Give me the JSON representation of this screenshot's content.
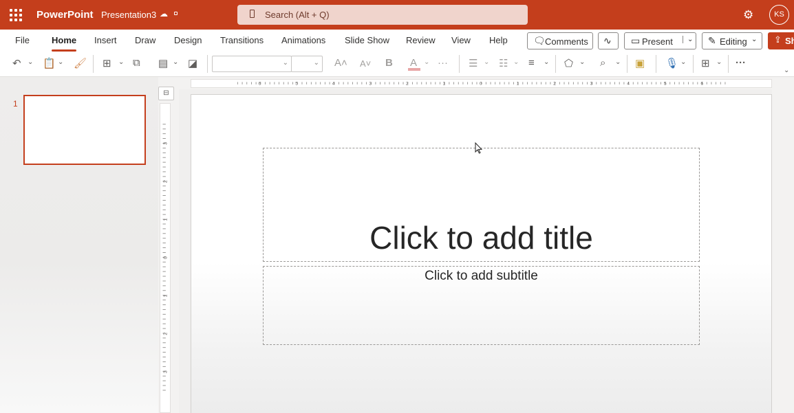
{
  "app": {
    "name": "PowerPoint",
    "document": "Presentation3",
    "search_placeholder": "Search (Alt + Q)",
    "user_initials": "KS"
  },
  "tabs": [
    "File",
    "Home",
    "Insert",
    "Draw",
    "Design",
    "Transitions",
    "Animations",
    "Slide Show",
    "Review",
    "View",
    "Help"
  ],
  "active_tab": "Home",
  "actions": {
    "comments": "Comments",
    "present": "Present",
    "editing": "Editing",
    "share": "Sh"
  },
  "ribbon": {
    "bold": "B",
    "font_color": "A",
    "more": "···",
    "grow_font": "A˄",
    "shrink_font": "A˅"
  },
  "slides": {
    "count_label": "1"
  },
  "placeholders": {
    "title": "Click to add title",
    "subtitle": "Click to add subtitle"
  },
  "ruler": {
    "h_ticks": [
      "6",
      "5",
      "4",
      "3",
      "2",
      "1",
      "0",
      "1",
      "2",
      "3",
      "4",
      "5",
      "6"
    ],
    "v_ticks": [
      "3",
      "2",
      "1",
      "0",
      "1",
      "2",
      "3"
    ]
  },
  "colors": {
    "brand": "#c43e1c",
    "search_bg": "#f0d4cc"
  },
  "icons": [
    "waffle-icon",
    "cloud-saved-icon",
    "search-icon",
    "settings-gear-icon",
    "undo-icon",
    "paste-icon",
    "format-painter-icon",
    "new-slide-icon",
    "reuse-slides-icon",
    "layout-icon",
    "background-icon",
    "bullets-icon",
    "numbering-icon",
    "align-icon",
    "shapes-icon",
    "find-icon",
    "designer-icon",
    "dictate-icon",
    "add-ins-icon",
    "comment-icon",
    "activity-icon",
    "present-icon",
    "pencil-icon",
    "share-icon"
  ]
}
